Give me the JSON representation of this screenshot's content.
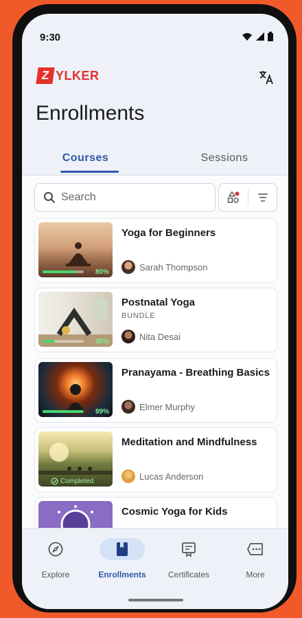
{
  "status": {
    "time": "9:30"
  },
  "brand": {
    "logo_letter": "Z",
    "logo_text": "YLKER"
  },
  "page": {
    "title": "Enrollments"
  },
  "tabs": [
    {
      "label": "Courses",
      "active": true
    },
    {
      "label": "Sessions",
      "active": false
    }
  ],
  "search": {
    "placeholder": "Search"
  },
  "courses": [
    {
      "title": "Yoga for Beginners",
      "tag": "",
      "instructor": "Sarah Thompson",
      "progress_text": "80%",
      "progress": 80
    },
    {
      "title": "Postnatal Yoga",
      "tag": "BUNDLE",
      "instructor": "Nita Desai",
      "progress_text": "30%",
      "progress": 30
    },
    {
      "title": "Pranayama - Breathing Basics",
      "tag": "",
      "instructor": "Elmer Murphy",
      "progress_text": "99%",
      "progress": 99
    },
    {
      "title": "Meditation and Mindfulness",
      "tag": "",
      "instructor": "Lucas Anderson",
      "status_text": "Completed",
      "progress": 100
    },
    {
      "title": "Cosmic Yoga for Kids",
      "tag": "",
      "instructor": ""
    }
  ],
  "nav": [
    {
      "label": "Explore",
      "icon": "compass-icon"
    },
    {
      "label": "Enrollments",
      "icon": "book-icon",
      "active": true
    },
    {
      "label": "Certificates",
      "icon": "certificate-icon"
    },
    {
      "label": "More",
      "icon": "more-icon"
    }
  ],
  "colors": {
    "accent": "#2f58a8",
    "brand": "#e4312b",
    "frame": "#f0592a"
  }
}
